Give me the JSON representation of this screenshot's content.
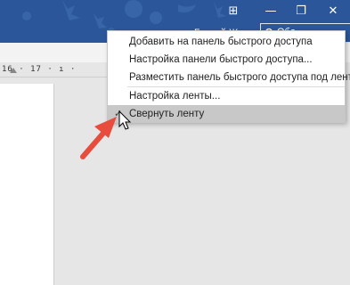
{
  "window": {
    "ribbon_display_icon": "ribbon-display-options-icon",
    "minimize_glyph": "—",
    "restore_glyph": "❐",
    "close_glyph": "✕",
    "user_name_fragment": "Благий Ж",
    "search_fragment": "Обо",
    "accent": "#2b579a"
  },
  "ruler": {
    "text": "16 · 17 · ı ·"
  },
  "menu": {
    "items": [
      {
        "label": "Добавить на панель быстрого доступа"
      },
      {
        "label": "Настройка панели быстрого доступа..."
      },
      {
        "label": "Разместить панель быстрого доступа под лентой"
      },
      {
        "label": "Настройка ленты..."
      },
      {
        "label": "Свернуть ленту",
        "checked": true,
        "check_glyph": "✓"
      }
    ],
    "hover_color": "#c8c8c8"
  },
  "annotation": {
    "arrow_color": "#e74c3c"
  }
}
